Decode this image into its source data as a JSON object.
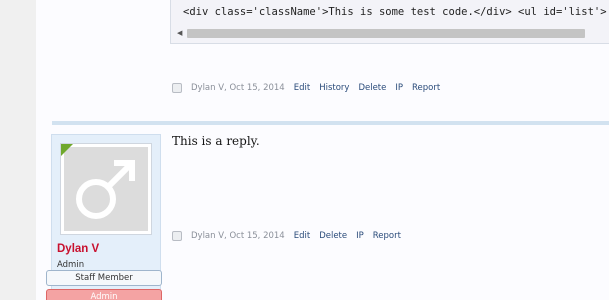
{
  "code_block": {
    "line": "<div class='className'>This is some test code.</div> <ul id='list'>"
  },
  "post1": {
    "author_date": "Dylan V, Oct 15, 2014",
    "actions": [
      "Edit",
      "History",
      "Delete",
      "IP",
      "Report"
    ]
  },
  "post2": {
    "body": "This is a reply.",
    "author_date": "Dylan V, Oct 15, 2014",
    "actions": [
      "Edit",
      "Delete",
      "IP",
      "Report"
    ],
    "user": {
      "name": "Dylan V",
      "title": "Admin",
      "banners": [
        "Staff Member",
        "Admin"
      ]
    }
  },
  "colors": {
    "username": "#c8102e",
    "online": "#6fa82c",
    "link": "#2a4b7a",
    "admin_banner": "#f4a3a3"
  },
  "icons": {
    "avatar": "male-symbol-icon",
    "scroll_left": "arrow-left-icon"
  }
}
